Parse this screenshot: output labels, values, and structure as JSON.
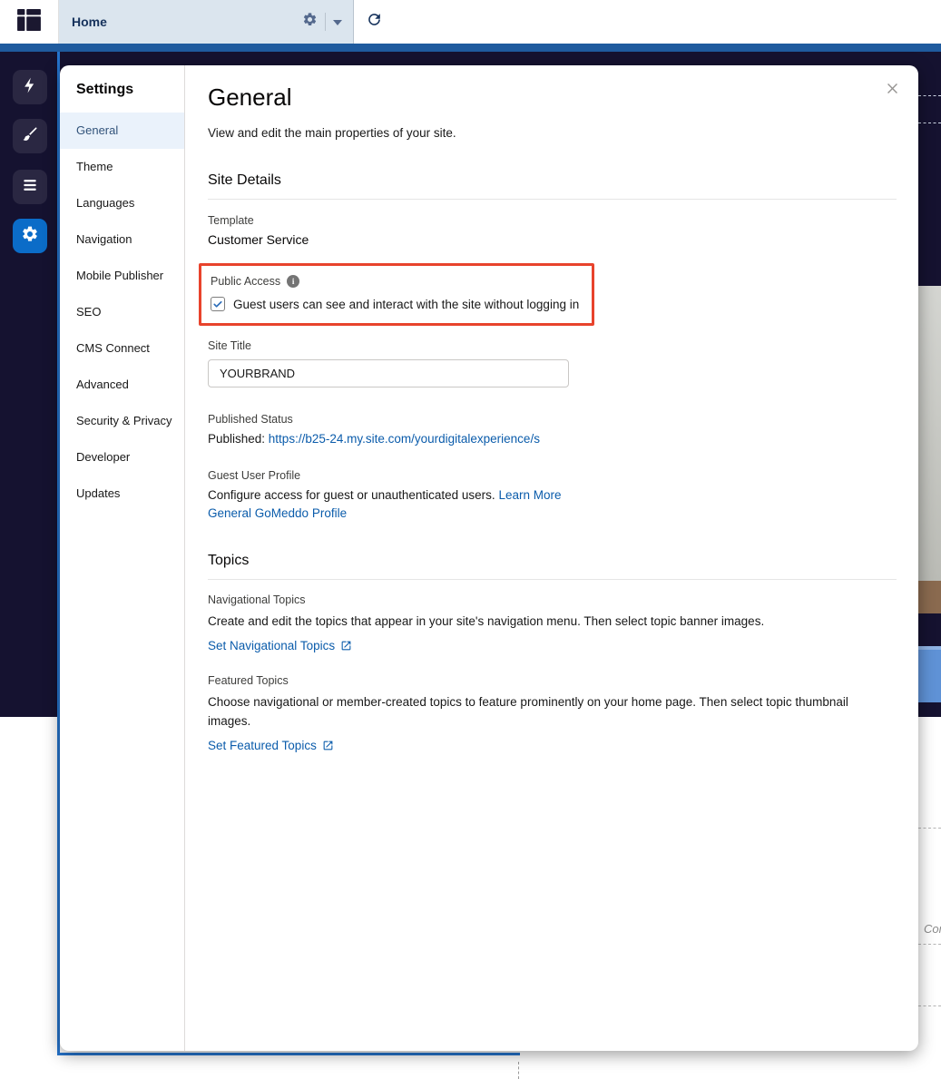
{
  "top_bar": {
    "page_name": "Home"
  },
  "rail": {
    "items": [
      {
        "name": "components",
        "icon": "lightning-icon"
      },
      {
        "name": "theme",
        "icon": "brush-icon"
      },
      {
        "name": "structure",
        "icon": "list-icon"
      },
      {
        "name": "settings",
        "icon": "gear-icon",
        "active": true
      }
    ]
  },
  "settings_nav": {
    "title": "Settings",
    "items": [
      {
        "label": "General",
        "active": true
      },
      {
        "label": "Theme"
      },
      {
        "label": "Languages"
      },
      {
        "label": "Navigation"
      },
      {
        "label": "Mobile Publisher"
      },
      {
        "label": "SEO"
      },
      {
        "label": "CMS Connect"
      },
      {
        "label": "Advanced"
      },
      {
        "label": "Security & Privacy"
      },
      {
        "label": "Developer"
      },
      {
        "label": "Updates"
      }
    ]
  },
  "general": {
    "title": "General",
    "subtitle": "View and edit the main properties of your site.",
    "site_details": {
      "heading": "Site Details",
      "template_label": "Template",
      "template_value": "Customer Service",
      "public_access_label": "Public Access",
      "public_access_checkbox_label": "Guest users can see and interact with the site without logging in",
      "public_access_checked": true,
      "site_title_label": "Site Title",
      "site_title_value": "YOURBRAND",
      "published_status_label": "Published Status",
      "published_prefix": "Published: ",
      "published_url": "https://b25-24.my.site.com/yourdigitalexperience/s",
      "guest_profile_label": "Guest User Profile",
      "guest_profile_text": "Configure access for guest or unauthenticated users. ",
      "guest_profile_learn_more": "Learn More",
      "guest_profile_link": "General GoMeddo Profile"
    },
    "topics": {
      "heading": "Topics",
      "nav_topics_label": "Navigational Topics",
      "nav_topics_desc": "Create and edit the topics that appear in your site's navigation menu. Then select topic banner images.",
      "nav_topics_link": "Set Navigational Topics",
      "featured_topics_label": "Featured Topics",
      "featured_topics_desc": "Choose navigational or member-created topics to feature prominently on your home page. Then select topic thumbnail images.",
      "featured_topics_link": "Set Featured Topics"
    }
  },
  "background": {
    "partial_text": "Cor"
  },
  "colors": {
    "accent_blue": "#0b5cab",
    "annotation_red": "#e8432c",
    "dark_overlay": "#151230",
    "active_rail_blue": "#0b6cc8"
  }
}
